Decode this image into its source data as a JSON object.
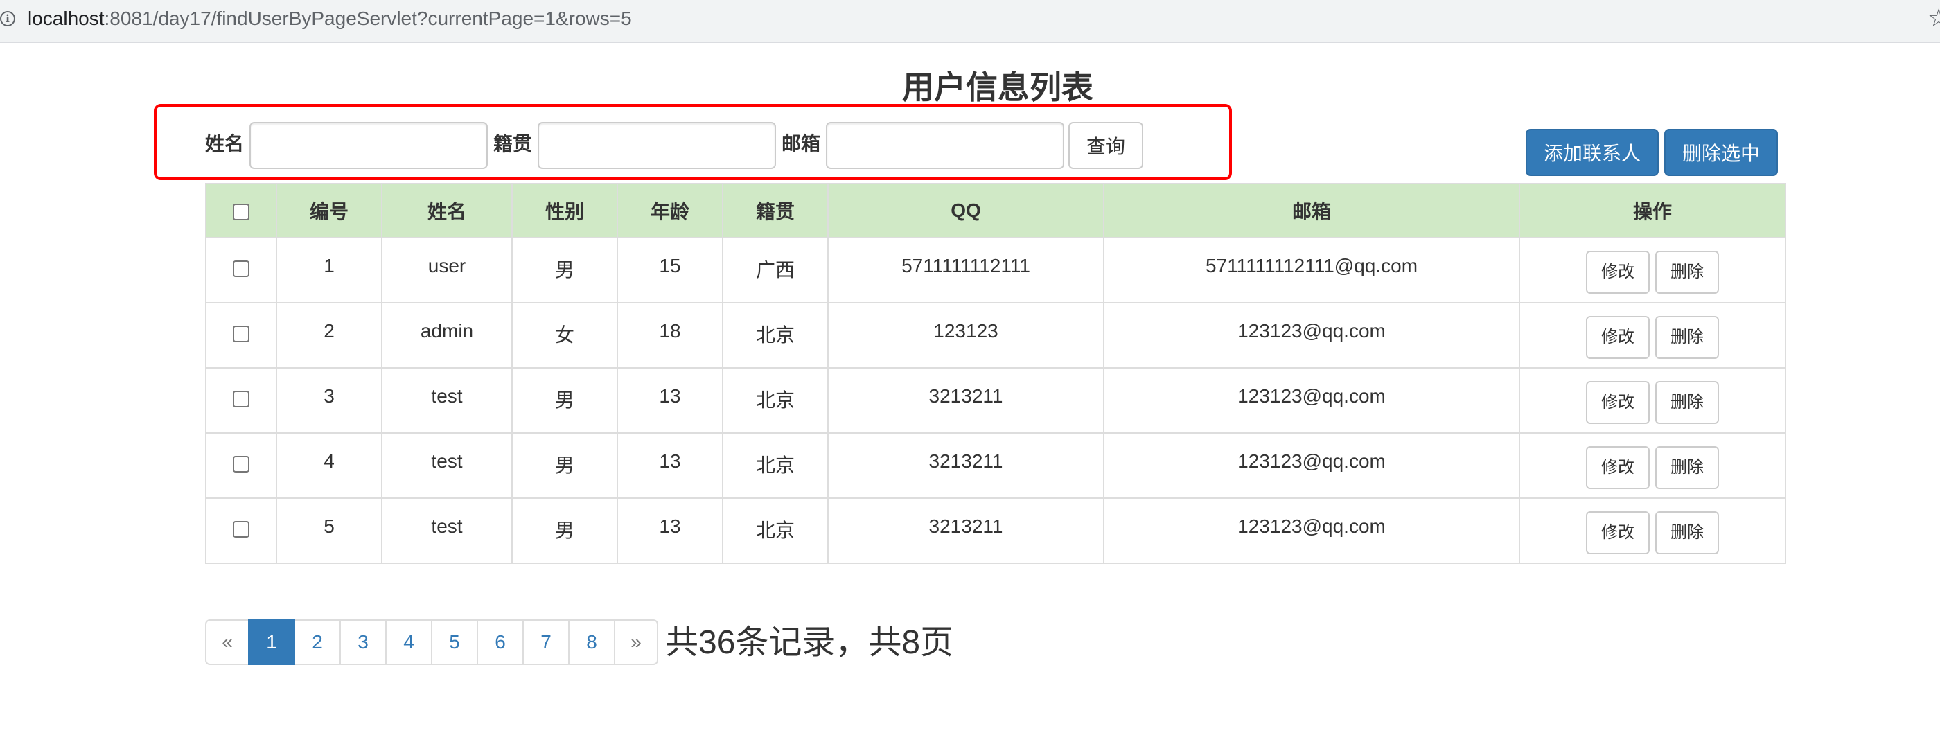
{
  "browser": {
    "url_host": "localhost",
    "url_rest": ":8081/day17/findUserByPageServlet?currentPage=1&rows=5",
    "info_icon": "info-icon",
    "star_icon": "bookmark-star-icon"
  },
  "page": {
    "title": "用户信息列表"
  },
  "search": {
    "name_label": "姓名",
    "name_value": "",
    "address_label": "籍贯",
    "address_value": "",
    "email_label": "邮箱",
    "email_value": "",
    "query_button": "查询"
  },
  "actions": {
    "add_button": "添加联系人",
    "delete_selected_button": "删除选中"
  },
  "table": {
    "headers": [
      "编号",
      "姓名",
      "性别",
      "年龄",
      "籍贯",
      "QQ",
      "邮箱",
      "操作"
    ],
    "rows": [
      {
        "id": "1",
        "name": "user",
        "gender": "男",
        "age": "15",
        "address": "广西",
        "qq": "5711111112111",
        "email": "5711111112111@qq.com",
        "edit": "修改",
        "delete": "删除"
      },
      {
        "id": "2",
        "name": "admin",
        "gender": "女",
        "age": "18",
        "address": "北京",
        "qq": "123123",
        "email": "123123@qq.com",
        "edit": "修改",
        "delete": "删除"
      },
      {
        "id": "3",
        "name": "test",
        "gender": "男",
        "age": "13",
        "address": "北京",
        "qq": "3213211",
        "email": "123123@qq.com",
        "edit": "修改",
        "delete": "删除"
      },
      {
        "id": "4",
        "name": "test",
        "gender": "男",
        "age": "13",
        "address": "北京",
        "qq": "3213211",
        "email": "123123@qq.com",
        "edit": "修改",
        "delete": "删除"
      },
      {
        "id": "5",
        "name": "test",
        "gender": "男",
        "age": "13",
        "address": "北京",
        "qq": "3213211",
        "email": "123123@qq.com",
        "edit": "修改",
        "delete": "删除"
      }
    ]
  },
  "pagination": {
    "prev": "«",
    "pages": [
      "1",
      "2",
      "3",
      "4",
      "5",
      "6",
      "7",
      "8"
    ],
    "current": "1",
    "next": "»",
    "summary": "共36条记录，共8页"
  },
  "colors": {
    "primary": "#337ab7",
    "header_row": "#d0e9c6",
    "highlight_box": "#ff0000"
  }
}
